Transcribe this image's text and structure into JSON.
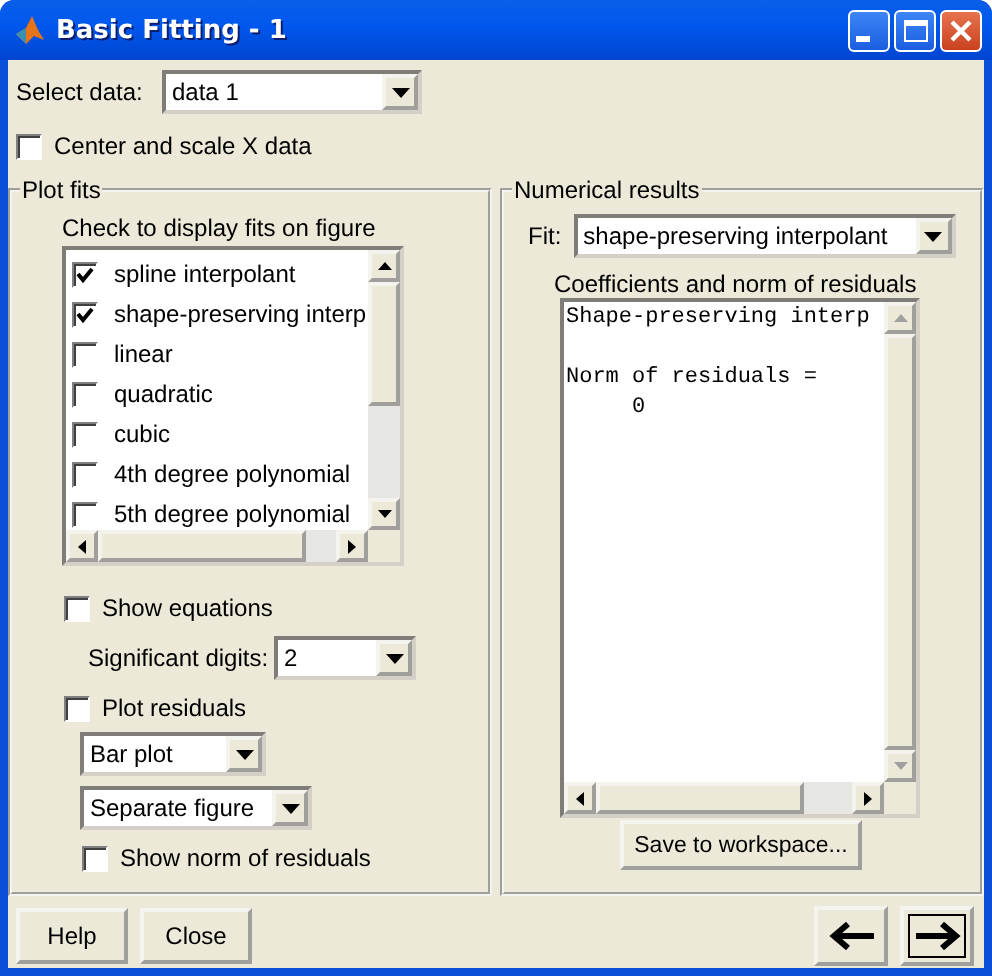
{
  "window": {
    "title": "Basic Fitting - 1"
  },
  "select_data": {
    "label": "Select data:",
    "value": "data 1"
  },
  "center_scale": {
    "label": "Center and scale X data",
    "checked": false
  },
  "plot_fits": {
    "title": "Plot fits",
    "hint": "Check to display fits on figure",
    "fits": [
      {
        "label": "spline interpolant",
        "checked": true
      },
      {
        "label": "shape-preserving interp",
        "checked": true
      },
      {
        "label": "linear",
        "checked": false
      },
      {
        "label": "quadratic",
        "checked": false
      },
      {
        "label": "cubic",
        "checked": false
      },
      {
        "label": "4th degree polynomial",
        "checked": false
      },
      {
        "label": "5th degree polynomial",
        "checked": false
      }
    ],
    "show_equations": {
      "label": "Show equations",
      "checked": false
    },
    "significant_digits": {
      "label": "Significant digits:",
      "value": "2"
    },
    "plot_residuals": {
      "label": "Plot residuals",
      "checked": false
    },
    "residual_plot_type": {
      "value": "Bar plot"
    },
    "residual_location": {
      "value": "Separate figure"
    },
    "show_norm": {
      "label": "Show norm of residuals",
      "checked": false
    }
  },
  "numerical_results": {
    "title": "Numerical results",
    "fit": {
      "label": "Fit:",
      "value": "shape-preserving interpolant"
    },
    "coefficients_label": "Coefficients and norm of residuals",
    "output": "Shape-preserving interp\n\nNorm of residuals =\n     0",
    "save_button": "Save to workspace..."
  },
  "buttons": [
    {
      "label": "Help"
    },
    {
      "label": "Close"
    }
  ]
}
